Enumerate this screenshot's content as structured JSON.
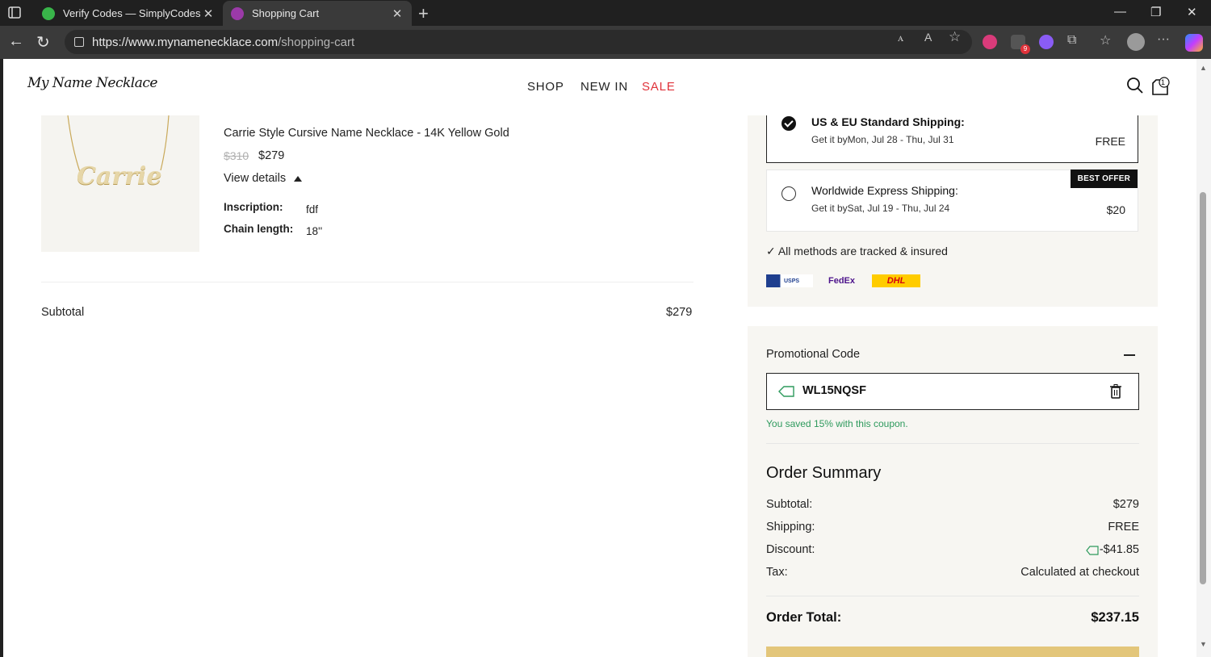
{
  "browser": {
    "tabs": [
      {
        "title": "Verify Codes — SimplyCodes",
        "favicon_color": "#39b54a"
      },
      {
        "title": "Shopping Cart",
        "favicon_color": "#9b3aa8"
      }
    ],
    "url_host": "https://www.mynamenecklace.com",
    "url_path": "/shopping-cart",
    "extension_badge": "9"
  },
  "header": {
    "logo": "My Name Necklace",
    "nav": [
      "SHOP",
      "NEW IN",
      "SALE"
    ],
    "cart_count": "1"
  },
  "product": {
    "name": "Carrie Style Cursive Name Necklace - 14K Yellow Gold",
    "old_price": "$310",
    "price": "$279",
    "view_details": "View details",
    "image_text": "Carrie",
    "attributes": [
      {
        "label": "Inscription:",
        "value": "fdf"
      },
      {
        "label": "Chain length:",
        "value": "18''"
      }
    ]
  },
  "cart": {
    "subtotal_label": "Subtotal",
    "subtotal_value": "$279"
  },
  "shipping": {
    "options": [
      {
        "title": "US & EU Standard Shipping:",
        "eta": "Get it byMon, Jul 28 - Thu, Jul 31",
        "price": "FREE",
        "selected": true
      },
      {
        "title": "Worldwide Express Shipping:",
        "eta": "Get it bySat, Jul 19 - Thu, Jul 24",
        "price": "$20",
        "selected": false,
        "badge": "BEST OFFER"
      }
    ],
    "tracked_note": "✓ All methods are tracked & insured",
    "carriers": [
      "USPS",
      "FedEx",
      "DHL"
    ]
  },
  "promo": {
    "title": "Promotional Code",
    "code": "WL15NQSF",
    "saved_message": "You saved 15% with this coupon."
  },
  "order_summary": {
    "title": "Order Summary",
    "rows": [
      {
        "label": "Subtotal:",
        "value": "$279"
      },
      {
        "label": "Shipping:",
        "value": "FREE"
      },
      {
        "label": "Discount:",
        "value": "-$41.85"
      },
      {
        "label": "Tax:",
        "value": "Calculated at checkout"
      }
    ],
    "total_label": "Order Total:",
    "total_value": "$237.15"
  },
  "colors": {
    "sale": "#e0323a",
    "saved_green": "#2e9a5d",
    "checkout_button": "#e3c67a"
  }
}
